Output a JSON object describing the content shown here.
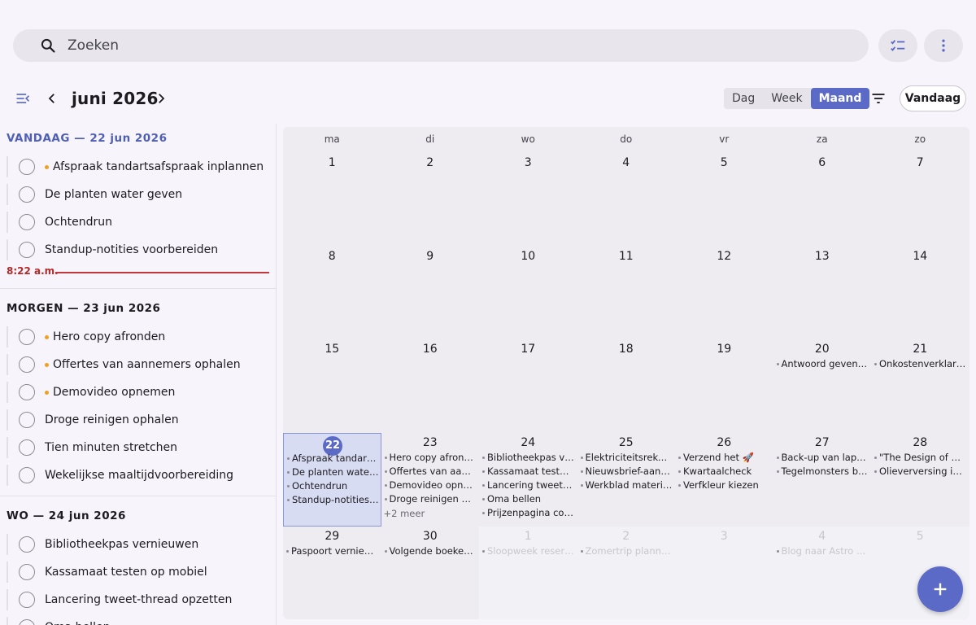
{
  "search": {
    "placeholder": "Zoeken"
  },
  "toolbar": {
    "month_title": "juni 2026",
    "views": [
      "Dag",
      "Week",
      "Maand"
    ],
    "active_view": "Maand",
    "today_label": "Vandaag"
  },
  "sidebar": {
    "now_time": "8:22 a.m.",
    "groups": [
      {
        "title": "VANDAAG — 22 jun 2026",
        "tasks": [
          {
            "label": "Afspraak tandartsafspraak inplannen",
            "dot": true
          },
          {
            "label": "De planten water geven",
            "dot": false
          },
          {
            "label": "Ochtendrun",
            "dot": false
          },
          {
            "label": "Standup-notities voorbereiden",
            "dot": false
          }
        ]
      },
      {
        "title": "MORGEN — 23 jun 2026",
        "tasks": [
          {
            "label": "Hero copy afronden",
            "dot": true
          },
          {
            "label": "Offertes van aannemers ophalen",
            "dot": true
          },
          {
            "label": "Demovideo opnemen",
            "dot": true
          },
          {
            "label": "Droge reinigen ophalen",
            "dot": false
          },
          {
            "label": "Tien minuten stretchen",
            "dot": false
          },
          {
            "label": "Wekelijkse maaltijdvoorbereiding",
            "dot": false
          }
        ]
      },
      {
        "title": "WO — 24 jun 2026",
        "tasks": [
          {
            "label": "Bibliotheekpas vernieuwen",
            "dot": false
          },
          {
            "label": "Kassamaat testen op mobiel",
            "dot": false
          },
          {
            "label": "Lancering tweet-thread opzetten",
            "dot": false
          },
          {
            "label": "Oma bellen",
            "dot": false
          }
        ]
      }
    ]
  },
  "calendar": {
    "weekdays": [
      "ma",
      "di",
      "wo",
      "do",
      "vr",
      "za",
      "zo"
    ],
    "today": 22,
    "weeks": [
      [
        {
          "d": "1",
          "events": []
        },
        {
          "d": "2",
          "events": []
        },
        {
          "d": "3",
          "events": []
        },
        {
          "d": "4",
          "events": []
        },
        {
          "d": "5",
          "events": []
        },
        {
          "d": "6",
          "events": []
        },
        {
          "d": "7",
          "events": []
        }
      ],
      [
        {
          "d": "8",
          "events": []
        },
        {
          "d": "9",
          "events": []
        },
        {
          "d": "10",
          "events": []
        },
        {
          "d": "11",
          "events": []
        },
        {
          "d": "12",
          "events": []
        },
        {
          "d": "13",
          "events": []
        },
        {
          "d": "14",
          "events": []
        }
      ],
      [
        {
          "d": "15",
          "events": []
        },
        {
          "d": "16",
          "events": []
        },
        {
          "d": "17",
          "events": []
        },
        {
          "d": "18",
          "events": []
        },
        {
          "d": "19",
          "events": []
        },
        {
          "d": "20",
          "events": [
            "Antwoord geven op mail"
          ]
        },
        {
          "d": "21",
          "events": [
            "Onkostenverklaring indienen"
          ]
        }
      ],
      [
        {
          "d": "22",
          "events": [
            "Afspraak tandartsafspraak inplannen",
            "De planten water geven",
            "Ochtendrun",
            "Standup-notities voorbereiden"
          ]
        },
        {
          "d": "23",
          "events": [
            "Hero copy afronden",
            "Offertes van aannemers ophalen",
            "Demovideo opnemen",
            "Droge reinigen ophalen"
          ],
          "more": "+2 meer"
        },
        {
          "d": "24",
          "events": [
            "Bibliotheekpas vernieuwen",
            "Kassamaat testen op mobiel",
            "Lancering tweet-thread opzetten",
            "Oma bellen",
            "Prijzenpagina controleren"
          ]
        },
        {
          "d": "25",
          "events": [
            "Elektriciteitsrekening betalen",
            "Nieuwsbrief-aankondiging",
            "Werkblad materiaal"
          ]
        },
        {
          "d": "26",
          "events": [
            "Verzend het 🚀",
            "Kwartaalcheck",
            "Verfkleur kiezen"
          ]
        },
        {
          "d": "27",
          "events": [
            "Back-up van laptop maken",
            "Tegelmonsters bestellen"
          ]
        },
        {
          "d": "28",
          "events": [
            "\"The Design of Everyday Things\"",
            "Olieverversing inplannen"
          ]
        }
      ],
      [
        {
          "d": "29",
          "events": [
            "Paspoort vernieuwen"
          ]
        },
        {
          "d": "30",
          "events": [
            "Volgende boekenclub"
          ]
        },
        {
          "d": "1",
          "out": true,
          "events": [
            "Sloopweek reserveren"
          ]
        },
        {
          "d": "2",
          "out": true,
          "events": [
            "Zomertrip plannen"
          ]
        },
        {
          "d": "3",
          "out": true,
          "events": []
        },
        {
          "d": "4",
          "out": true,
          "events": [
            "Blog naar Astro migreren"
          ]
        },
        {
          "d": "5",
          "out": true,
          "events": []
        }
      ]
    ]
  },
  "icons": {
    "search": "search-icon",
    "tasks": "checklist-icon",
    "more": "more-vert-icon",
    "menu": "menu-collapse-icon",
    "prev": "chevron-left-icon",
    "next": "chevron-right-icon",
    "filter": "filter-icon",
    "add": "add-icon"
  },
  "colors": {
    "accent": "#5b6ac7",
    "now_line": "#c0393b",
    "priority_dot": "#f0a020"
  }
}
